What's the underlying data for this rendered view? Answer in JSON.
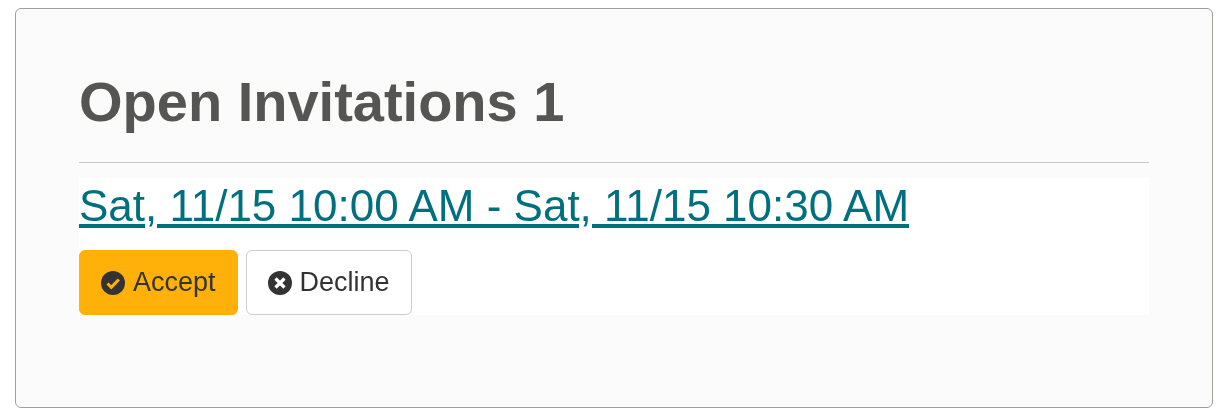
{
  "heading": "Open Invitations 1",
  "invitations": [
    {
      "time_range": "Sat, 11/15 10:00 AM - Sat, 11/15 10:30 AM",
      "buttons": [
        {
          "label": "Accept",
          "kind": "accept"
        },
        {
          "label": "Decline",
          "kind": "decline"
        }
      ]
    }
  ]
}
